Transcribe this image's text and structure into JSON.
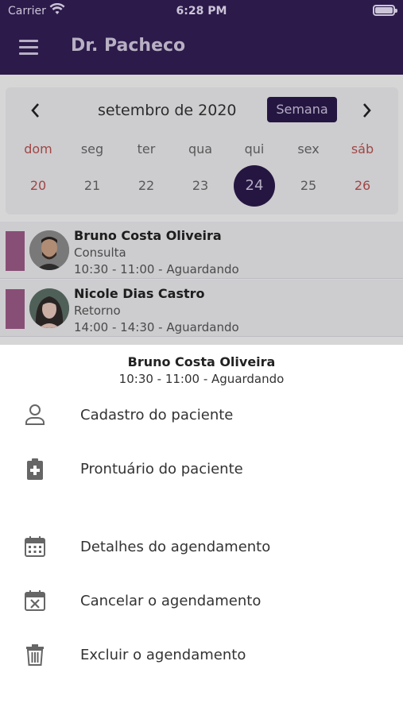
{
  "status_bar": {
    "carrier": "Carrier",
    "time": "6:28 PM"
  },
  "app_bar": {
    "title": "Dr. Pacheco",
    "menu_icon": "hamburger-icon"
  },
  "calendar": {
    "month": "setembro de 2020",
    "view_button": "Semana",
    "prev_icon": "chevron-left-icon",
    "next_icon": "chevron-right-icon",
    "weekdays": [
      "dom",
      "seg",
      "ter",
      "qua",
      "qui",
      "sex",
      "sáb"
    ],
    "dates": [
      "20",
      "21",
      "22",
      "23",
      "24",
      "25",
      "26"
    ],
    "selected_date": "24",
    "colors": {
      "weekend": "#b5524f",
      "selected": "#2b1a4a"
    }
  },
  "appointments": [
    {
      "name": "Bruno Costa Oliveira",
      "type": "Consulta",
      "info": "10:30 - 11:00 - Aguardando"
    },
    {
      "name": "Nicole Dias Castro",
      "type": "Retorno",
      "info": "14:00 - 14:30 - Aguardando"
    }
  ],
  "sheet": {
    "name": "Bruno Costa Oliveira",
    "info": "10:30 - 11:00 - Aguardando",
    "actions": [
      {
        "label": "Cadastro do paciente",
        "icon": "person-icon"
      },
      {
        "label": "Prontuário do paciente",
        "icon": "medical-clipboard-icon"
      },
      {
        "label": "Detalhes do agendamento",
        "icon": "calendar-icon"
      },
      {
        "label": "Cancelar o agendamento",
        "icon": "calendar-cancel-icon"
      },
      {
        "label": "Excluir o agendamento",
        "icon": "trash-icon"
      }
    ]
  },
  "colors": {
    "primary": "#2b1a4a",
    "accent_bar": "#9b5a87"
  }
}
